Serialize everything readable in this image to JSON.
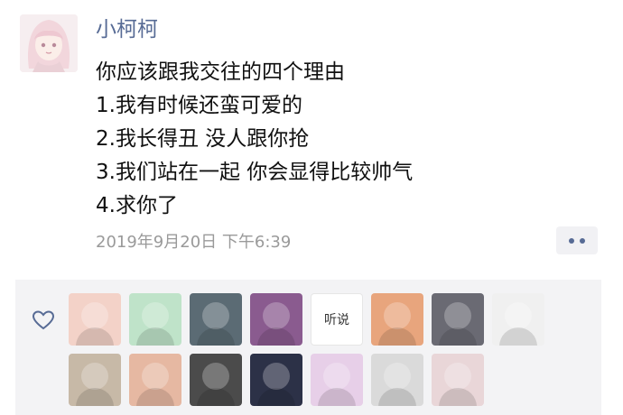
{
  "post": {
    "username": "小柯柯",
    "lines": [
      "你应该跟我交往的四个理由",
      "1.我有时候还蛮可爱的",
      "2.我长得丑 没人跟你抢",
      "3.我们站在一起 你会显得比较帅气",
      "4.求你了"
    ],
    "timestamp": "2019年9月20日 下午6:39"
  },
  "likes": {
    "avatars_row1": [
      {
        "icon": "cartoon-avatar",
        "color": "#f3d2c8"
      },
      {
        "icon": "pig-avatar",
        "color": "#bfe3c9"
      },
      {
        "icon": "face-avatar",
        "color": "#5b6b74"
      },
      {
        "icon": "anime-avatar",
        "color": "#8a5b8f"
      },
      {
        "icon": "text-avatar",
        "color": "#ffffff",
        "text": "听说"
      },
      {
        "icon": "anime-girl-avatar",
        "color": "#e8a57d"
      },
      {
        "icon": "silhouette-avatar",
        "color": "#6a6a73"
      },
      {
        "icon": "pumpkin-avatar",
        "color": "#f0f0f0"
      }
    ],
    "avatars_row2": [
      {
        "icon": "child-avatar",
        "color": "#c7b9a7"
      },
      {
        "icon": "child-face-avatar",
        "color": "#e6b8a2"
      },
      {
        "icon": "fog-avatar",
        "color": "#4b4b4b"
      },
      {
        "icon": "anime-dark-avatar",
        "color": "#2c3147"
      },
      {
        "icon": "anime-pastel-avatar",
        "color": "#e7cfe8"
      },
      {
        "icon": "portrait-avatar",
        "color": "#dadada"
      },
      {
        "icon": "christmas-avatar",
        "color": "#e9d6d8"
      }
    ]
  }
}
